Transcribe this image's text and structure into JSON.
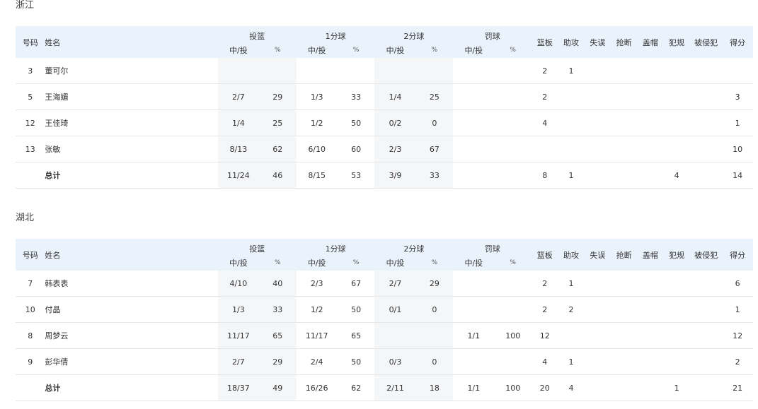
{
  "headers": {
    "number": "号码",
    "name": "姓名",
    "fg": "投篮",
    "one_pt": "1分球",
    "two_pt": "2分球",
    "ft": "罚球",
    "made_att": "中/投",
    "pct": "%",
    "rebounds": "篮板",
    "assists": "助攻",
    "turnovers": "失误",
    "steals": "抢断",
    "blocks": "盖帽",
    "fouls": "犯规",
    "fouled": "被侵犯",
    "points": "得分"
  },
  "teams": [
    {
      "name": "浙江",
      "rows": [
        {
          "number": "3",
          "name": "董可尔",
          "fg_ma": "",
          "fg_pct": "",
          "p1_ma": "",
          "p1_pct": "",
          "p2_ma": "",
          "p2_pct": "",
          "ft_ma": "",
          "ft_pct": "",
          "reb": "2",
          "ast": "1",
          "tov": "",
          "stl": "",
          "blk": "",
          "pf": "",
          "fd": "",
          "pts": ""
        },
        {
          "number": "5",
          "name": "王海媚",
          "fg_ma": "2/7",
          "fg_pct": "29",
          "p1_ma": "1/3",
          "p1_pct": "33",
          "p2_ma": "1/4",
          "p2_pct": "25",
          "ft_ma": "",
          "ft_pct": "",
          "reb": "2",
          "ast": "",
          "tov": "",
          "stl": "",
          "blk": "",
          "pf": "",
          "fd": "",
          "pts": "3"
        },
        {
          "number": "12",
          "name": "王佳琦",
          "fg_ma": "1/4",
          "fg_pct": "25",
          "p1_ma": "1/2",
          "p1_pct": "50",
          "p2_ma": "0/2",
          "p2_pct": "0",
          "ft_ma": "",
          "ft_pct": "",
          "reb": "4",
          "ast": "",
          "tov": "",
          "stl": "",
          "blk": "",
          "pf": "",
          "fd": "",
          "pts": "1"
        },
        {
          "number": "13",
          "name": "张敏",
          "fg_ma": "8/13",
          "fg_pct": "62",
          "p1_ma": "6/10",
          "p1_pct": "60",
          "p2_ma": "2/3",
          "p2_pct": "67",
          "ft_ma": "",
          "ft_pct": "",
          "reb": "",
          "ast": "",
          "tov": "",
          "stl": "",
          "blk": "",
          "pf": "",
          "fd": "",
          "pts": "10"
        }
      ],
      "total": {
        "number": "",
        "name": "总计",
        "fg_ma": "11/24",
        "fg_pct": "46",
        "p1_ma": "8/15",
        "p1_pct": "53",
        "p2_ma": "3/9",
        "p2_pct": "33",
        "ft_ma": "",
        "ft_pct": "",
        "reb": "8",
        "ast": "1",
        "tov": "",
        "stl": "",
        "blk": "",
        "pf": "4",
        "fd": "",
        "pts": "14"
      }
    },
    {
      "name": "湖北",
      "rows": [
        {
          "number": "7",
          "name": "韩表表",
          "fg_ma": "4/10",
          "fg_pct": "40",
          "p1_ma": "2/3",
          "p1_pct": "67",
          "p2_ma": "2/7",
          "p2_pct": "29",
          "ft_ma": "",
          "ft_pct": "",
          "reb": "2",
          "ast": "1",
          "tov": "",
          "stl": "",
          "blk": "",
          "pf": "",
          "fd": "",
          "pts": "6"
        },
        {
          "number": "10",
          "name": "付晶",
          "fg_ma": "1/3",
          "fg_pct": "33",
          "p1_ma": "1/2",
          "p1_pct": "50",
          "p2_ma": "0/1",
          "p2_pct": "0",
          "ft_ma": "",
          "ft_pct": "",
          "reb": "2",
          "ast": "2",
          "tov": "",
          "stl": "",
          "blk": "",
          "pf": "",
          "fd": "",
          "pts": "1"
        },
        {
          "number": "8",
          "name": "周梦云",
          "fg_ma": "11/17",
          "fg_pct": "65",
          "p1_ma": "11/17",
          "p1_pct": "65",
          "p2_ma": "",
          "p2_pct": "",
          "ft_ma": "1/1",
          "ft_pct": "100",
          "reb": "12",
          "ast": "",
          "tov": "",
          "stl": "",
          "blk": "",
          "pf": "",
          "fd": "",
          "pts": "12"
        },
        {
          "number": "9",
          "name": "彭华倩",
          "fg_ma": "2/7",
          "fg_pct": "29",
          "p1_ma": "2/4",
          "p1_pct": "50",
          "p2_ma": "0/3",
          "p2_pct": "0",
          "ft_ma": "",
          "ft_pct": "",
          "reb": "4",
          "ast": "1",
          "tov": "",
          "stl": "",
          "blk": "",
          "pf": "",
          "fd": "",
          "pts": "2"
        }
      ],
      "total": {
        "number": "",
        "name": "总计",
        "fg_ma": "18/37",
        "fg_pct": "49",
        "p1_ma": "16/26",
        "p1_pct": "62",
        "p2_ma": "2/11",
        "p2_pct": "18",
        "ft_ma": "1/1",
        "ft_pct": "100",
        "reb": "20",
        "ast": "4",
        "tov": "",
        "stl": "",
        "blk": "",
        "pf": "1",
        "fd": "",
        "pts": "21"
      }
    }
  ]
}
